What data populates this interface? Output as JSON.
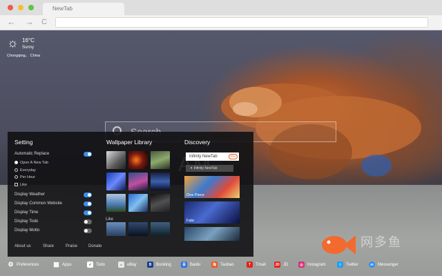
{
  "browser": {
    "tab_title": "NewTab",
    "back_glyph": "←",
    "forward_glyph": "→",
    "reload_glyph": "C",
    "traffic_colors": [
      "#ee5a52",
      "#f4bd38",
      "#5ec542"
    ]
  },
  "weather": {
    "icon": "sun-icon",
    "temperature": "16°C",
    "condition": "Sunny",
    "location": "Chongqing，  China"
  },
  "search": {
    "placeholder": "Search"
  },
  "clock": {
    "time": "AM"
  },
  "setting": {
    "title": "Setting",
    "auto_replace_label": "Automatic Replace",
    "options": [
      {
        "label": "Open A New Tab",
        "selected": true
      },
      {
        "label": "Everyday",
        "selected": false
      },
      {
        "label": "Per Hour",
        "selected": false
      },
      {
        "label": "Like",
        "selected": false
      }
    ],
    "toggles": [
      {
        "label": "Display Weather",
        "on": true
      },
      {
        "label": "Display Common Website",
        "on": true
      },
      {
        "label": "Display Time",
        "on": true
      },
      {
        "label": "Display Todo",
        "on": false
      },
      {
        "label": "Display Motto",
        "on": false
      }
    ],
    "footer": [
      "About us",
      "Share",
      "Praise",
      "Donate"
    ]
  },
  "wallpaper_library": {
    "title": "Wallpaper Library",
    "like_label": "Like",
    "accent": "#3a8ef0"
  },
  "discovery": {
    "title": "Discovery",
    "header_label": "Infinity NewTab",
    "badge": "Pro",
    "sub_label": "Infinity NewTab",
    "cards": [
      {
        "caption": "One Piece"
      },
      {
        "caption": "Fate"
      }
    ]
  },
  "dock": {
    "items": [
      {
        "label": "Preferences",
        "icon": "gear-icon",
        "color": "#444444"
      },
      {
        "label": "Apps",
        "icon": "grid-icon",
        "color": "#444444"
      },
      {
        "label": "Todo",
        "icon": "check-icon",
        "color": "#ffffff"
      },
      {
        "label": "eBay",
        "icon": "ebay-icon",
        "color": "#e8e8e8"
      },
      {
        "label": "Booking",
        "icon": "booking-icon",
        "color": "#1b3f8f"
      },
      {
        "label": "Baidu",
        "icon": "baidu-icon",
        "color": "#2f6de1"
      },
      {
        "label": "Taobao",
        "icon": "taobao-icon",
        "color": "#f25322"
      },
      {
        "label": "Tmail",
        "icon": "tmall-icon",
        "color": "#e2231a"
      },
      {
        "label": "JD",
        "icon": "jd-icon",
        "color": "#e1251b"
      },
      {
        "label": "Instagram",
        "icon": "instagram-icon",
        "color": "#d6337a"
      },
      {
        "label": "Twitter",
        "icon": "twitter-icon",
        "color": "#1da1f2"
      },
      {
        "label": "Messenger",
        "icon": "messenger-icon",
        "color": "#2b8ff4"
      }
    ]
  },
  "watermark": {
    "text": "网多鱼"
  }
}
